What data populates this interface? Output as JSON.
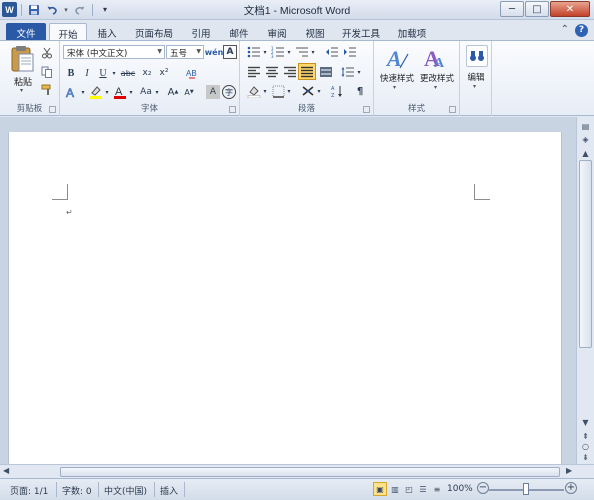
{
  "window": {
    "title": "文档1 - Microsoft Word",
    "controls": {
      "minimize": "─",
      "maximize": "□",
      "close": "✕"
    }
  },
  "quick_access": {
    "app_letter": "W",
    "save": "💾",
    "undo": "↶",
    "redo": "↺",
    "customize": "▾"
  },
  "tabs": [
    {
      "label": "文件"
    },
    {
      "label": "开始"
    },
    {
      "label": "插入"
    },
    {
      "label": "页面布局"
    },
    {
      "label": "引用"
    },
    {
      "label": "邮件"
    },
    {
      "label": "审阅"
    },
    {
      "label": "视图"
    },
    {
      "label": "开发工具"
    },
    {
      "label": "加载项"
    }
  ],
  "tab_right": {
    "minimize_ribbon": "⌃",
    "help": "?"
  },
  "ribbon": {
    "clipboard": {
      "group_label": "剪贴板",
      "paste_label": "粘贴"
    },
    "font": {
      "group_label": "字体",
      "font_name": "宋体 (中文正文)",
      "font_size": "五号",
      "bold": "B",
      "italic": "I",
      "underline": "U",
      "strike": "abc",
      "subscript": "x₂",
      "superscript": "x²",
      "case": "Aa",
      "grow": "A",
      "shrink": "A",
      "clear_format": "A",
      "phonetic": "A",
      "char_border": "A",
      "enclose": "字"
    },
    "paragraph": {
      "group_label": "段落"
    },
    "styles": {
      "group_label": "样式",
      "quick_styles": "快速样式",
      "change_styles": "更改样式"
    },
    "editing": {
      "label": "编辑"
    }
  },
  "document": {
    "paragraph_mark": "↵"
  },
  "status": {
    "page": "页面: 1/1",
    "words": "字数: 0",
    "language": "中文(中国)",
    "mode": "插入",
    "zoom": "100%",
    "zoom_minus": "−",
    "zoom_plus": "+",
    "zoom_level_percent": 100
  },
  "colors": {
    "file_tab": "#2a5aa6",
    "highlight": "#ffff00",
    "font_color": "#e00000",
    "active_view": "#ffe38a"
  }
}
